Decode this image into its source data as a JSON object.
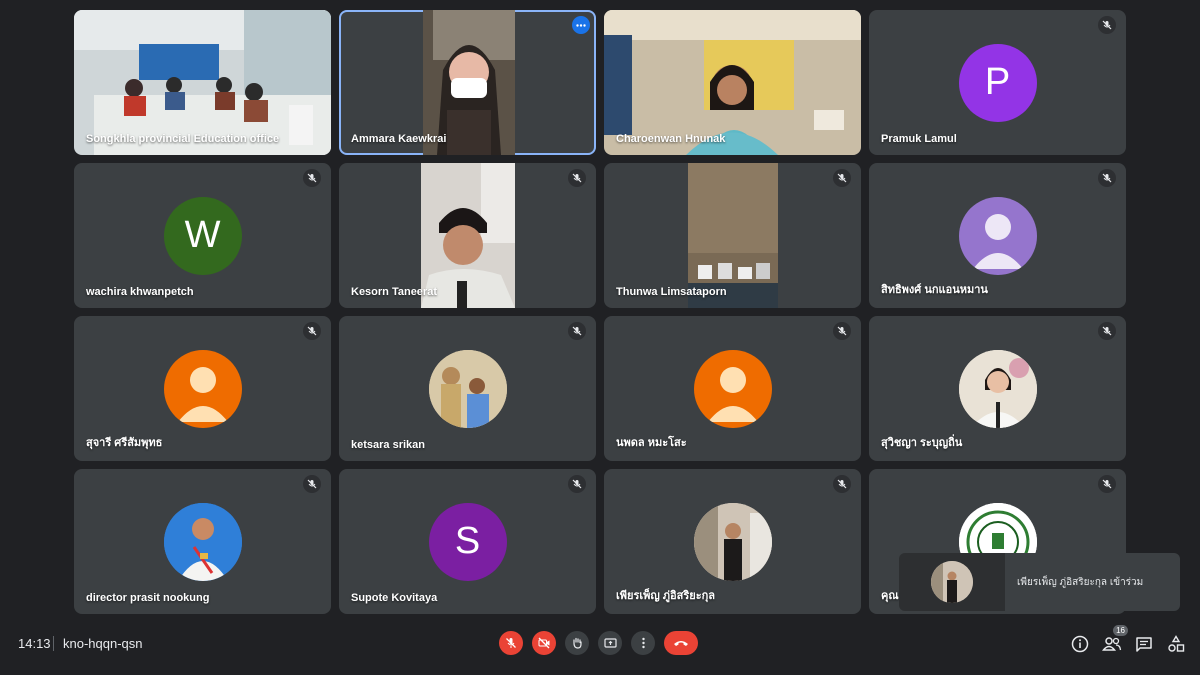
{
  "participants": [
    {
      "name": "Songkhla provincial Education office"
    },
    {
      "name": "Ammara Kaewkrai"
    },
    {
      "name": "Charoenwan Hnunak"
    },
    {
      "name": "Pramuk Lamul",
      "initial": "P",
      "color": "#9334e6"
    },
    {
      "name": "wachira khwanpetch",
      "initial": "W",
      "color": "#33691e"
    },
    {
      "name": "Kesorn Taneerat"
    },
    {
      "name": "Thunwa Limsataporn"
    },
    {
      "name": "สิทธิพงศ์ นกแอนหมาน",
      "color": "#9575cd"
    },
    {
      "name": "สุจารี ศรีสัมพุทธ",
      "color": "#ef6c00"
    },
    {
      "name": "ketsara srikan"
    },
    {
      "name": "นพดล หมะโสะ",
      "color": "#ef6c00"
    },
    {
      "name": "สุวิชญา ระบุญถิ่น"
    },
    {
      "name": "director prasit nookung"
    },
    {
      "name": "Supote Kovitaya",
      "initial": "S",
      "color": "#7b1fa2"
    },
    {
      "name": "เพียรเพ็ญ ภู่อิสริยะกุล"
    },
    {
      "name": "คุณ"
    }
  ],
  "meeting": {
    "time": "14:13",
    "code": "kno-hqqn-qsn",
    "participant_count": "16"
  },
  "toast": {
    "message": "เพียรเพ็ญ ภู่อิสริยะกุล เข้าร่วม"
  },
  "icons": {
    "mic_off": "mic-off-icon",
    "cam_off": "camera-off-icon",
    "hand": "raise-hand-icon",
    "present": "present-screen-icon",
    "more": "more-options-icon",
    "leave": "end-call-icon",
    "info": "info-icon",
    "people": "people-icon",
    "chat": "chat-icon",
    "activities": "activities-icon"
  },
  "colors": {
    "background": "#202124",
    "tile": "#3c4043",
    "active_border": "#8ab4f8",
    "danger": "#ea4335"
  }
}
